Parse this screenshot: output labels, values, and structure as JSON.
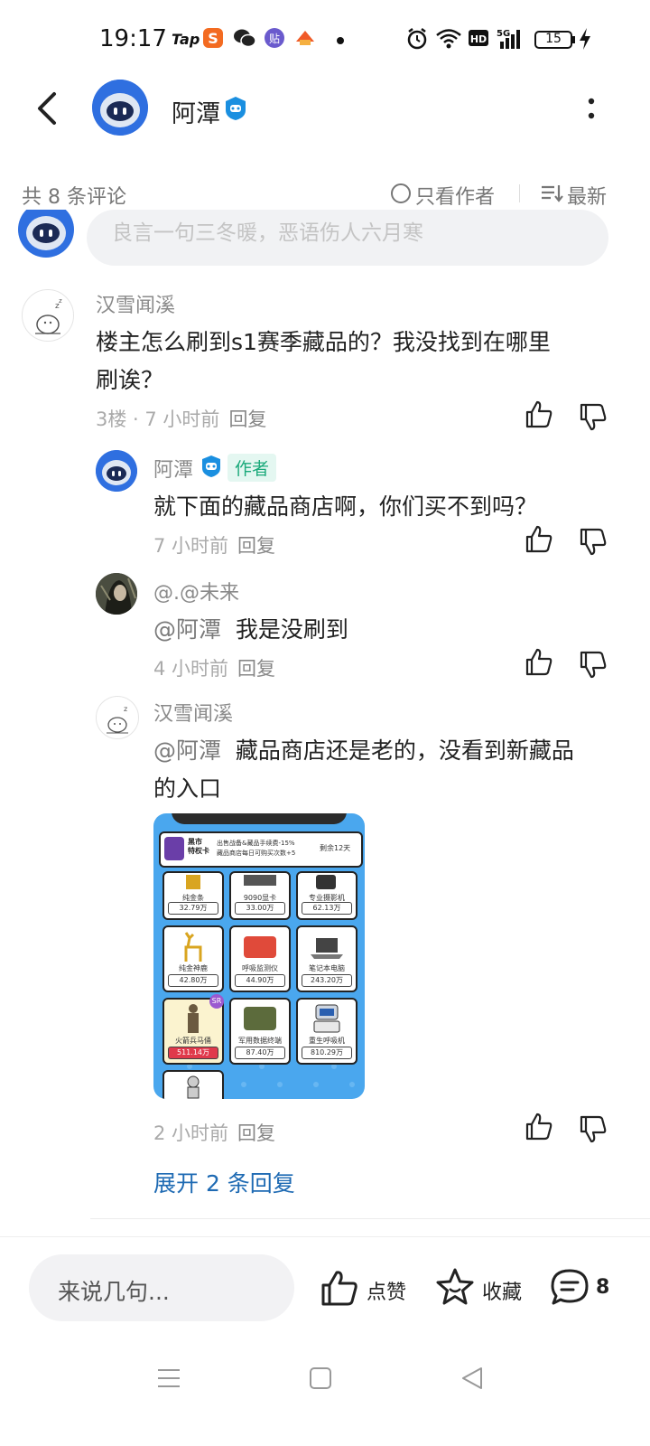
{
  "status_bar": {
    "time": "19:17",
    "tap": "Tap",
    "battery": "15"
  },
  "header": {
    "title": "阿潭"
  },
  "filter": {
    "count": "共 8 条评论",
    "only_author": "只看作者",
    "sort": "最新"
  },
  "partial_comment": {
    "text": "良言一句三冬暖，恶语伤人六月寒"
  },
  "comments": [
    {
      "name": "汉雪闻溪",
      "text_line1": "楼主怎么刷到s1赛季藏品的？我没找到在哪里",
      "text_line2": "刷诶？",
      "meta": "3楼 · 7 小时前",
      "reply": "回复"
    },
    {
      "name": "阿潭",
      "badge": "作者",
      "text": "就下面的藏品商店啊，你们买不到吗？",
      "meta": "7 小时前",
      "reply": "回复"
    },
    {
      "name": "@.@未来",
      "mention": "@阿潭",
      "text": "我是没刷到",
      "meta": "4 小时前",
      "reply": "回复"
    },
    {
      "name": "汉雪闻溪",
      "mention": "@阿潭",
      "text_line1": "藏品商店还是老的，没看到新藏品",
      "text_line2": "的入口",
      "meta": "2 小时前",
      "reply": "回复"
    }
  ],
  "screenshot": {
    "banner_title": "黑市\n特权卡",
    "banner_desc1": "出售战备&藏品手续费-15%",
    "banner_desc2": "藏品商店每日可购买次数+5",
    "banner_remaining": "剩余12天",
    "items": [
      {
        "name": "纯金条",
        "price": "32.79万"
      },
      {
        "name": "9090显卡",
        "price": "33.00万"
      },
      {
        "name": "专业摄影机",
        "price": "62.13万"
      },
      {
        "name": "纯金神鹿",
        "price": "42.80万"
      },
      {
        "name": "呼吸监测仪",
        "price": "44.90万"
      },
      {
        "name": "笔记本电脑",
        "price": "243.20万"
      },
      {
        "name": "火箭兵马俑",
        "price": "511.14万"
      },
      {
        "name": "军用数据终端",
        "price": "87.40万"
      },
      {
        "name": "重生呼吸机",
        "price": "810.29万"
      }
    ],
    "sr_badge": "SR"
  },
  "expand": {
    "label": "展开 2 条回复"
  },
  "bottom": {
    "input_placeholder": "来说几句...",
    "like": "点赞",
    "favorite": "收藏",
    "comment_count": "8"
  },
  "colors": {
    "accent_blue": "#1e6ab3",
    "author_badge": "#1aa97a",
    "robot_blue": "#2f6fe0"
  }
}
